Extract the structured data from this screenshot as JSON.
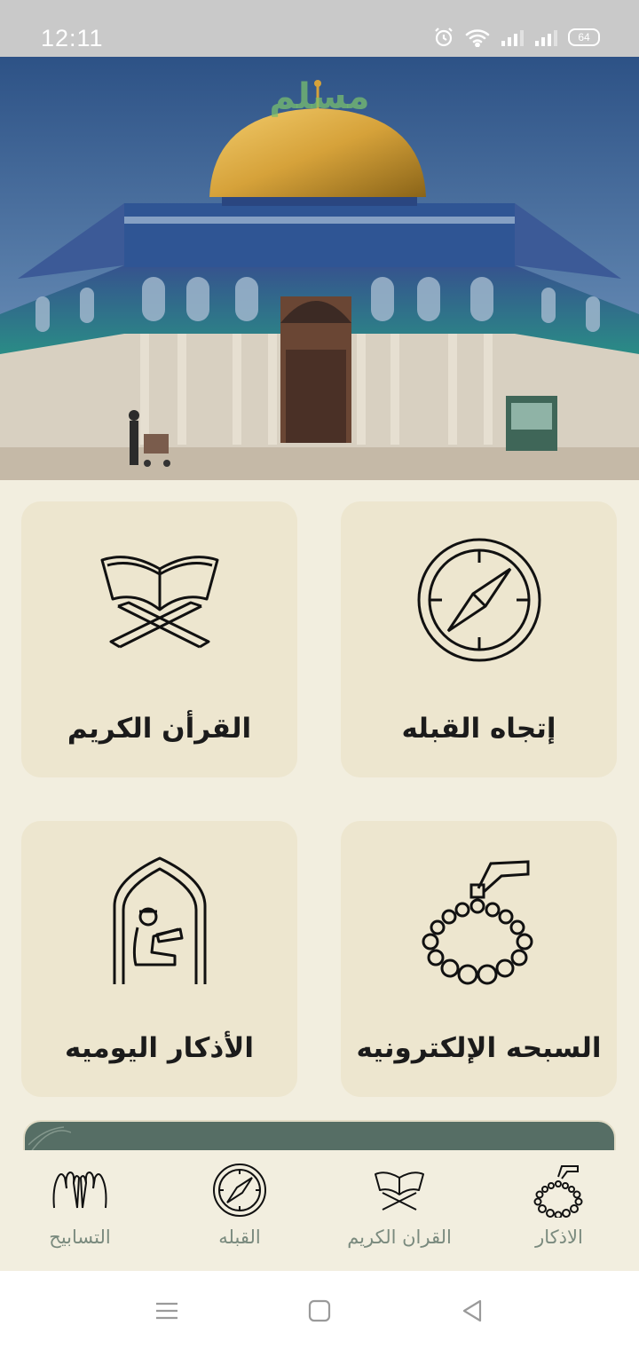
{
  "status_bar": {
    "time": "12:11",
    "battery": "64",
    "icons": [
      "alarm-icon",
      "wifi-icon",
      "signal-icon",
      "signal-icon"
    ]
  },
  "hero": {
    "app_name": "مسلم",
    "image": "dome-of-the-rock-photo"
  },
  "cards": {
    "qibla": {
      "label": "إتجاه القبله",
      "icon": "compass-icon"
    },
    "quran": {
      "label": "القرأن الكريم",
      "icon": "quran-stand-icon"
    },
    "tasbih": {
      "label": "السبحه الإلكترونيه",
      "icon": "prayer-beads-icon"
    },
    "azkar": {
      "label": "الأذكار اليوميه",
      "icon": "praying-person-icon"
    }
  },
  "bottom_nav": {
    "items": [
      {
        "label": "التسابيح",
        "icon": "praying-hands-icon"
      },
      {
        "label": "القبله",
        "icon": "compass-icon"
      },
      {
        "label": "القران الكريم",
        "icon": "quran-stand-icon"
      },
      {
        "label": "الاذكار",
        "icon": "prayer-beads-icon"
      }
    ]
  },
  "system_nav": {
    "buttons": [
      "menu-icon",
      "home-icon",
      "back-icon"
    ]
  },
  "colors": {
    "background": "#f2eedf",
    "card": "#ede6cf",
    "banner": "#566e65",
    "nav_label": "#7a8a7e",
    "status_bar": "#c9c9c9"
  }
}
